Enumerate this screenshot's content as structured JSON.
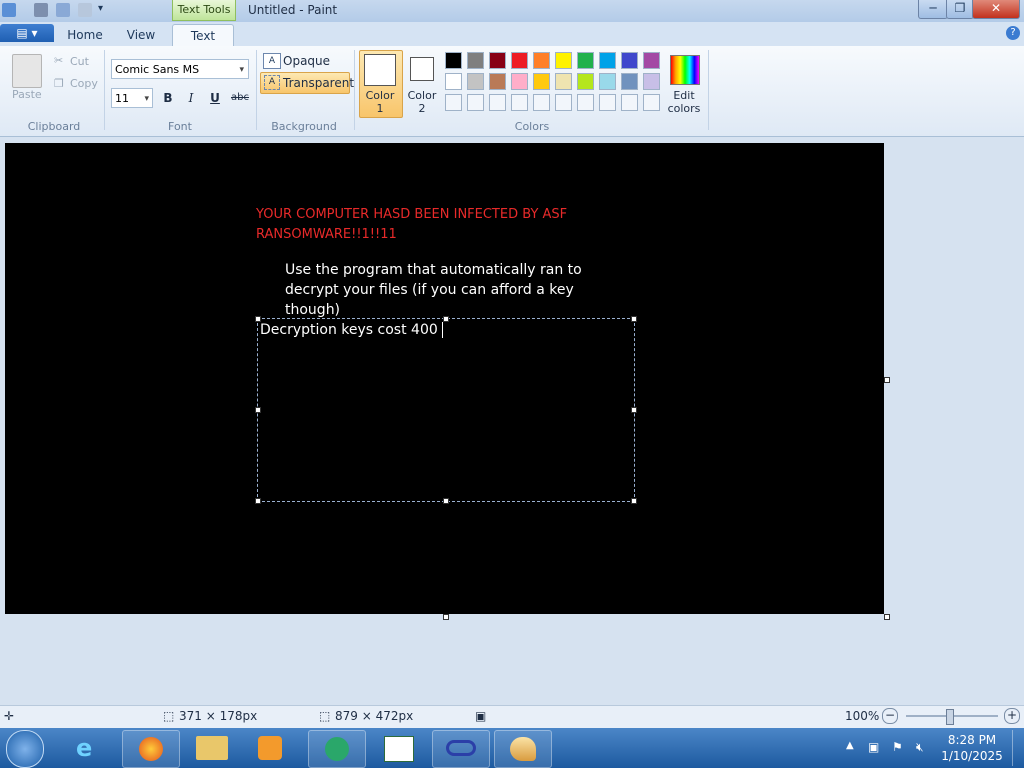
{
  "window": {
    "title": "Untitled - Paint",
    "context_tab": "Text Tools",
    "minimize_glyph": "─",
    "maximize_glyph": "❐",
    "close_glyph": "✕"
  },
  "ribbon_tabs": {
    "home": "Home",
    "view": "View",
    "text": "Text",
    "active": "Text"
  },
  "clipboard": {
    "paste": "Paste",
    "cut": "Cut",
    "copy": "Copy",
    "group": "Clipboard"
  },
  "font": {
    "family": "Comic Sans MS",
    "size": "11",
    "bold": "B",
    "italic": "I",
    "underline": "U",
    "strike": "abc",
    "group": "Font"
  },
  "background": {
    "opaque": "Opaque",
    "transparent": "Transparent",
    "selected": "Transparent",
    "group": "Background"
  },
  "colors": {
    "color1_label": "Color 1",
    "color1_line1": "Color",
    "color1_line2": "1",
    "color2_line1": "Color",
    "color2_line2": "2",
    "color1_value": "#ffffff",
    "color2_value": "#ffffff",
    "edit_line1": "Edit",
    "edit_line2": "colors",
    "group": "Colors",
    "palette_row1": [
      "#000000",
      "#7f7f7f",
      "#880015",
      "#ed1c24",
      "#ff7f27",
      "#fff200",
      "#22b14c",
      "#00a2e8",
      "#3f48cc",
      "#a349a4"
    ],
    "palette_row2": [
      "#ffffff",
      "#c3c3c3",
      "#b97a57",
      "#ffaec9",
      "#ffc90e",
      "#efe4b0",
      "#b5e61d",
      "#99d9ea",
      "#7092be",
      "#c8bfe7"
    ]
  },
  "canvas": {
    "headline_line1": "YOUR COMPUTER HASD BEEN INFECTED BY ASF",
    "headline_line2": "RANSOMWARE!!1!!11",
    "body_line1": "Use the program that automatically ran to",
    "body_line2": "decrypt your files (if you can afford a key",
    "body_line3": "though)",
    "typing": "Decryption keys cost 400",
    "headline_color": "#e82a2a",
    "background": "#000000"
  },
  "status": {
    "selection_size": "371 × 178px",
    "canvas_size": "879 × 472px",
    "zoom": "100%"
  },
  "taskbar": {
    "time": "8:28 PM",
    "date": "1/10/2025"
  }
}
